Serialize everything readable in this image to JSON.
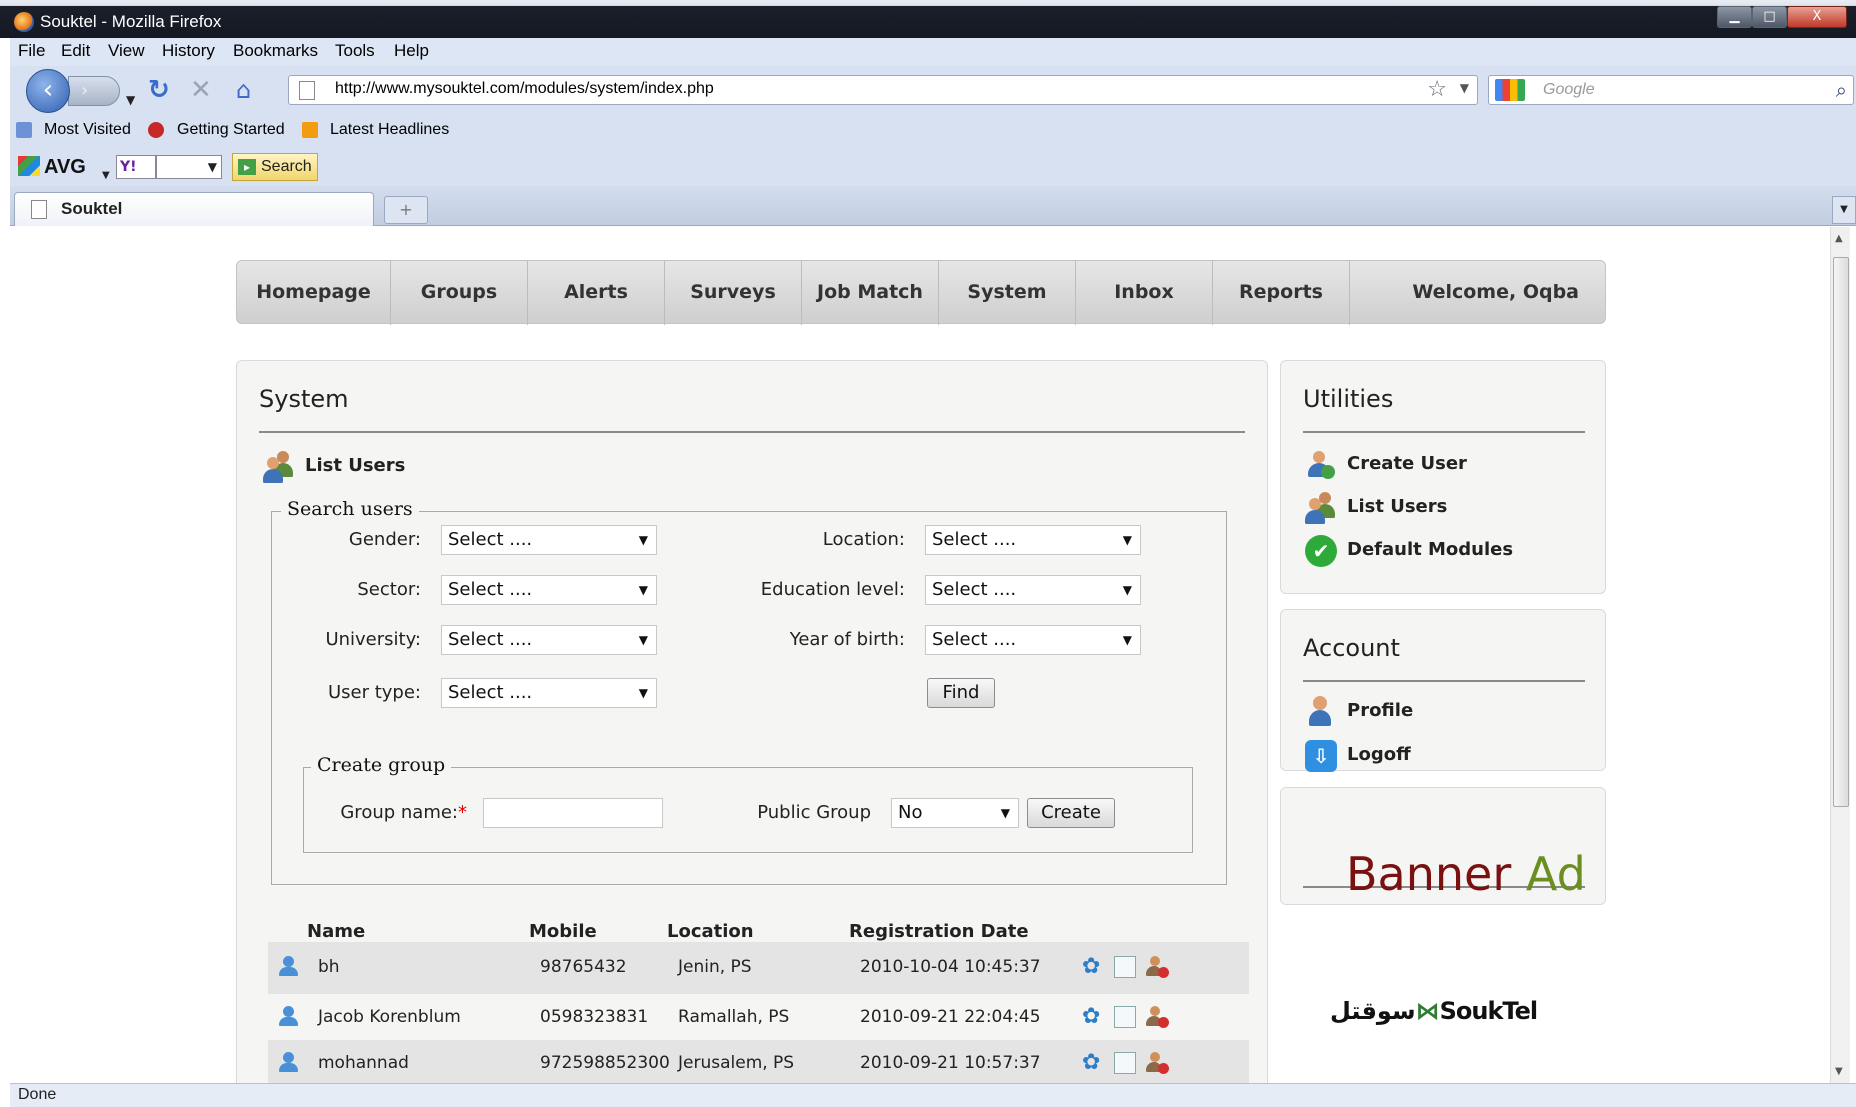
{
  "window": {
    "title": "Souktel - Mozilla Firefox",
    "controls": {
      "minimize": "▁",
      "maximize": "□",
      "close": "X"
    }
  },
  "menu": [
    "File",
    "Edit",
    "View",
    "History",
    "Bookmarks",
    "Tools",
    "Help"
  ],
  "browser": {
    "url": "http://www.mysouktel.com/modules/system/index.php",
    "search_placeholder": "Google",
    "bookmarks": [
      "Most Visited",
      "Getting Started",
      "Latest Headlines"
    ],
    "avg": {
      "logo": "AVG",
      "yahoo": "Y!",
      "search_label": "Search"
    },
    "tab_title": "Souktel",
    "status": "Done"
  },
  "nav": {
    "items": [
      "Homepage",
      "Groups",
      "Alerts",
      "Surveys",
      "Job Match",
      "System",
      "Inbox",
      "Reports"
    ],
    "welcome": "Welcome, Oqba"
  },
  "system": {
    "title": "System",
    "section": "List Users",
    "search_legend": "Search users",
    "filters": {
      "gender": {
        "label": "Gender:",
        "value": "Select ...."
      },
      "sector": {
        "label": "Sector:",
        "value": "Select ...."
      },
      "university": {
        "label": "University:",
        "value": "Select ...."
      },
      "user_type": {
        "label": "User type:",
        "value": "Select ...."
      },
      "location": {
        "label": "Location:",
        "value": "Select ...."
      },
      "education": {
        "label": "Education level:",
        "value": "Select ...."
      },
      "year_of_birth": {
        "label": "Year of birth:",
        "value": "Select ...."
      }
    },
    "find_label": "Find",
    "create_group": {
      "legend": "Create group",
      "group_name_label": "Group name:",
      "required_mark": "*",
      "group_name_value": "",
      "public_label": "Public Group",
      "public_value": "No",
      "create_label": "Create"
    },
    "table": {
      "headers": [
        "Name",
        "Mobile",
        "Location",
        "Registration Date"
      ],
      "rows": [
        {
          "name": "bh",
          "mobile": "98765432",
          "location": "Jenin, PS",
          "date": "2010-10-04 10:45:37"
        },
        {
          "name": "Jacob Korenblum",
          "mobile": "0598323831",
          "location": "Ramallah, PS",
          "date": "2010-09-21 22:04:45"
        },
        {
          "name": "mohannad",
          "mobile": "972598852300",
          "location": "Jerusalem, PS",
          "date": "2010-09-21 10:57:37"
        }
      ]
    }
  },
  "utilities": {
    "title": "Utilities",
    "items": [
      "Create User",
      "List Users",
      "Default Modules"
    ]
  },
  "account": {
    "title": "Account",
    "items": [
      "Profile",
      "Logoff"
    ]
  },
  "banner": {
    "word1": "Banner",
    "word2": "Ad",
    "color1": "#7a1010",
    "color2": "#6b8e23"
  },
  "logo": {
    "arabic": "سوقتل",
    "latin": "SoukTel"
  }
}
